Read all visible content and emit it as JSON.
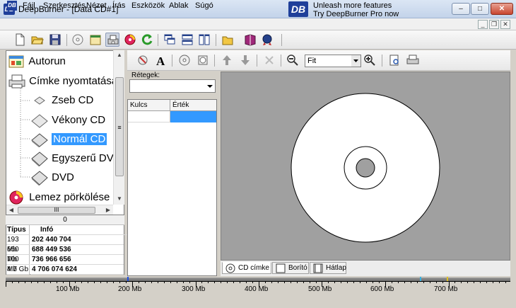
{
  "window": {
    "title": "DeepBurner - [Data CD#1]",
    "app_icon": "DB",
    "min_icon": "minimize-icon",
    "max_icon": "maximize-icon",
    "close_icon": "close-icon",
    "min_glyph": "–",
    "max_glyph": "□",
    "close_glyph": "✕"
  },
  "menu": {
    "items": [
      "Fájl",
      "Szerkesztés",
      "Nézet",
      "Írás",
      "Eszközök",
      "Ablak",
      "Súgó"
    ],
    "mdi_min": "_",
    "mdi_restore": "❐",
    "mdi_close": "✕"
  },
  "promo": {
    "logo": "DB",
    "line1": "Unleash more features",
    "line2": "Try DeepBurner Pro now"
  },
  "tree": {
    "items": [
      {
        "label": "Autorun",
        "icon": "autorun-icon",
        "level": 0
      },
      {
        "label": "Címke nyomtatása",
        "icon": "printer-icon",
        "level": 0
      },
      {
        "label": "Zseb CD",
        "icon": "pocket-cd-case-icon",
        "level": 1
      },
      {
        "label": "Vékony CD",
        "icon": "slim-cd-case-icon",
        "level": 1
      },
      {
        "label": "Normál CD",
        "icon": "normal-cd-case-icon",
        "level": 1,
        "selected": true
      },
      {
        "label": "Egyszerű DVD",
        "icon": "single-dvd-case-icon",
        "level": 1
      },
      {
        "label": "DVD",
        "icon": "dvd-case-icon",
        "level": 1
      },
      {
        "label": "Lemez pörkölése",
        "icon": "burn-disc-icon",
        "level": 0
      }
    ],
    "hscroll_thumb": "III",
    "up_arrow": "▲",
    "down_arrow": "▼",
    "left_arrow": "◀",
    "right_arrow": "▶",
    "vthumb_grip": "≡"
  },
  "disk_info": {
    "count": "0",
    "headers": [
      "Típus",
      "Infó"
    ],
    "rows": [
      {
        "type": "193 Mb",
        "size": "202 440 704"
      },
      {
        "type": "650 Mb",
        "size": "688 449 536"
      },
      {
        "type": "700 Mb",
        "size": "736 966 656"
      },
      {
        "type": "4.7 Gb",
        "size": "4 706 074 624"
      }
    ]
  },
  "layers": {
    "label": "Rétegek:",
    "value": ""
  },
  "properties": {
    "col_key": "Kulcs",
    "col_value": "Érték"
  },
  "zoom": {
    "value": "Fit"
  },
  "tabs": [
    {
      "label": "CD címke",
      "icon": "cd-label-icon",
      "active": true
    },
    {
      "label": "Borító",
      "icon": "cover-icon",
      "active": false
    },
    {
      "label": "Hátlap",
      "icon": "back-cover-icon",
      "active": false
    }
  ],
  "ruler": {
    "labels": [
      "100 Mb",
      "200 Mb",
      "300 Mb",
      "400 Mb",
      "500 Mb",
      "600 Mb",
      "700 Mb"
    ]
  },
  "colors": {
    "selection": "#3399ff",
    "canvas_bg": "#a0a0a0",
    "brand": "#1f3f9a"
  }
}
